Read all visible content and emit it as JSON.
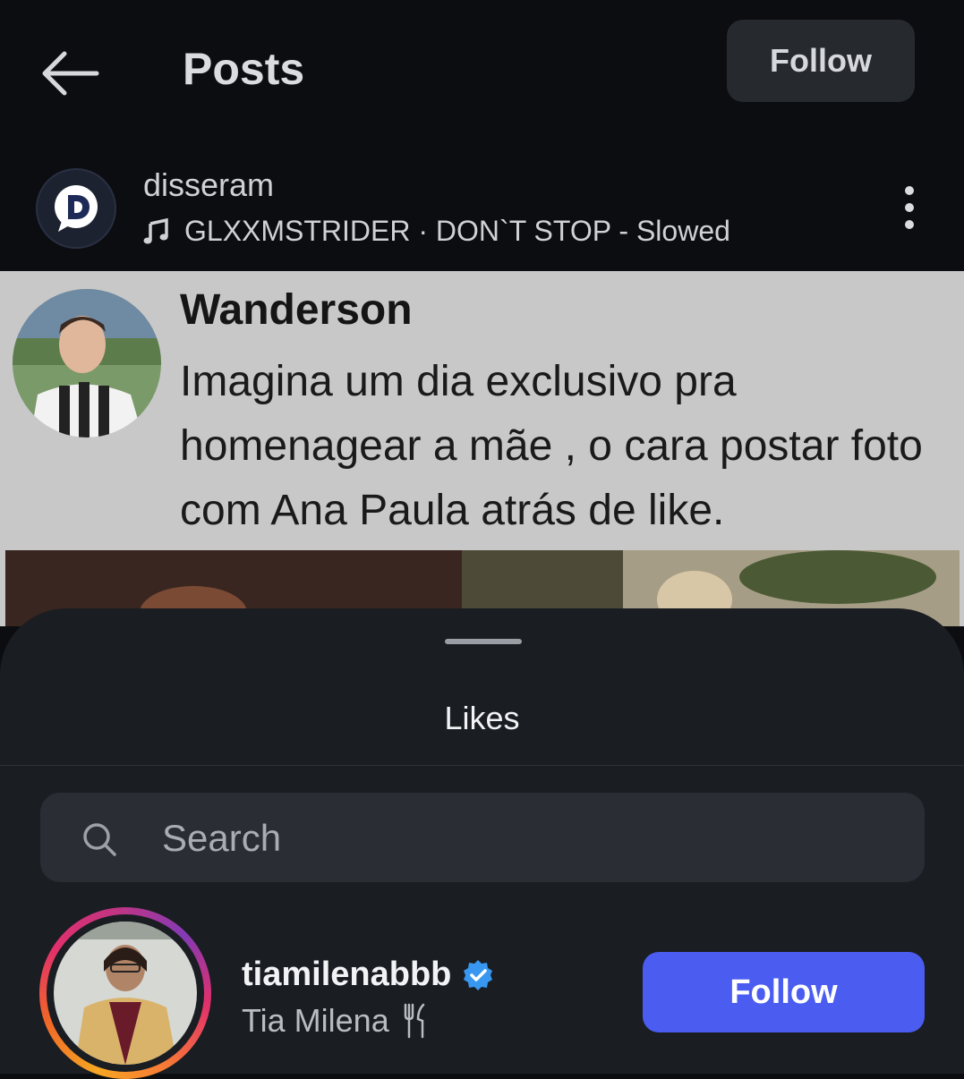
{
  "header": {
    "title": "Posts",
    "follow_label": "Follow"
  },
  "post": {
    "account_name": "disseram",
    "music": "GLXXMSTRIDER · DON`T STOP - Slowed"
  },
  "tweet": {
    "author": "Wanderson",
    "text": "Imagina um dia exclusivo pra homenagear a mãe ,  o cara  postar foto com Ana Paula atrás de like."
  },
  "likes_sheet": {
    "title": "Likes",
    "search_placeholder": "Search",
    "users": [
      {
        "username": "tiamilenabbb",
        "display_name": "Tia Milena",
        "verified": true,
        "follow_label": "Follow"
      }
    ]
  },
  "colors": {
    "follow_accent": "#4a5df0",
    "sheet_bg": "#1a1d22",
    "verified_badge": "#3897f0"
  }
}
